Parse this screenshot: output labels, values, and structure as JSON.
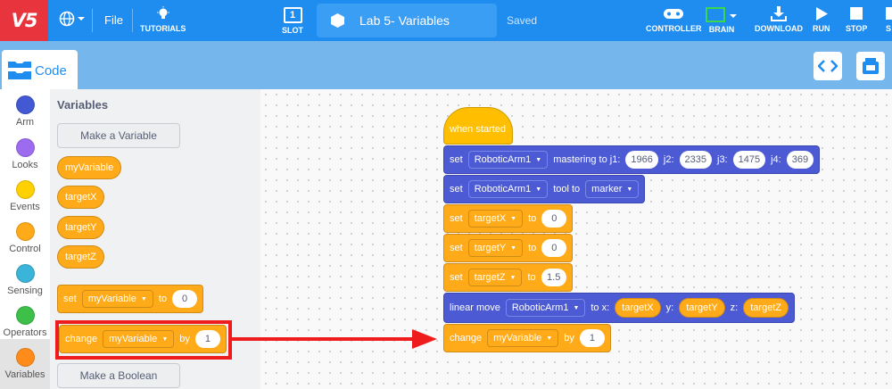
{
  "topbar": {
    "logo": "V5",
    "file_label": "File",
    "tutorials_label": "TUTORIALS",
    "slot_label": "SLOT",
    "slot_value": "1",
    "project_name": "Lab 5- Variables",
    "saved_label": "Saved",
    "controller_label": "CONTROLLER",
    "brain_label": "BRAIN",
    "download_label": "DOWNLOAD",
    "run_label": "RUN",
    "stop_label": "STOP",
    "cut_label": "S"
  },
  "code_tab": {
    "label": "Code"
  },
  "categories": [
    {
      "label": "Arm",
      "color": "#4359d4"
    },
    {
      "label": "Looks",
      "color": "#9c6bf0"
    },
    {
      "label": "Events",
      "color": "#ffd100"
    },
    {
      "label": "Control",
      "color": "#ffab19"
    },
    {
      "label": "Sensing",
      "color": "#3ab4d8"
    },
    {
      "label": "Operators",
      "color": "#3dbf4a"
    },
    {
      "label": "Variables",
      "color": "#ff8c1a"
    }
  ],
  "flyout": {
    "title": "Variables",
    "make_variable": "Make a Variable",
    "variables": [
      "myVariable",
      "targetX",
      "targetY",
      "targetZ"
    ],
    "set_block": {
      "kw": "set",
      "var": "myVariable",
      "to": "to",
      "value": "0"
    },
    "change_block": {
      "kw": "change",
      "var": "myVariable",
      "by": "by",
      "value": "1"
    },
    "make_boolean": "Make a Boolean"
  },
  "script": {
    "hat": "when started",
    "mastering": {
      "kw": "set",
      "device": "RoboticArm1",
      "text": "mastering to j1:",
      "j1": "1966",
      "j2_label": "j2:",
      "j2": "2335",
      "j3_label": "j3:",
      "j3": "1475",
      "j4_label": "j4:",
      "j4": "369"
    },
    "tool": {
      "kw": "set",
      "device": "RoboticArm1",
      "text": "tool to",
      "value": "marker"
    },
    "set_x": {
      "kw": "set",
      "var": "targetX",
      "to": "to",
      "value": "0"
    },
    "set_y": {
      "kw": "set",
      "var": "targetY",
      "to": "to",
      "value": "0"
    },
    "set_z": {
      "kw": "set",
      "var": "targetZ",
      "to": "to",
      "value": "1.5"
    },
    "move": {
      "kw": "linear move",
      "device": "RoboticArm1",
      "to_x": "to x:",
      "x": "targetX",
      "y_label": "y:",
      "y": "targetY",
      "z_label": "z:",
      "z": "targetZ"
    },
    "change": {
      "kw": "change",
      "var": "myVariable",
      "by": "by",
      "value": "1"
    }
  },
  "icons": [
    "globe-icon",
    "lightbulb-icon",
    "slot-icon",
    "hexagon-icon",
    "controller-icon",
    "brain-icon",
    "download-icon",
    "run-icon",
    "stop-icon",
    "code-view-icon",
    "device-icon"
  ],
  "annotation": {
    "color": "#ee1c1c"
  }
}
